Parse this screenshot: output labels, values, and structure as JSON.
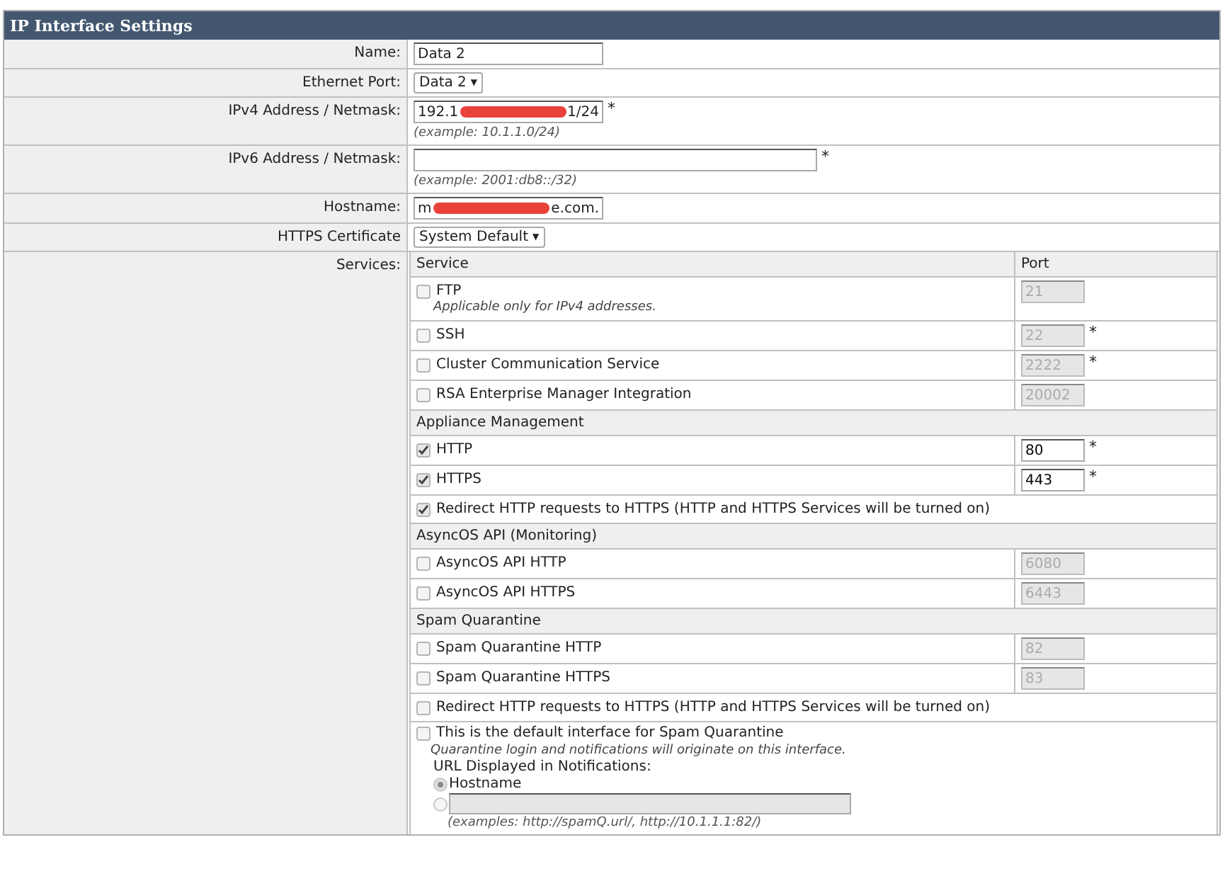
{
  "title": "IP Interface Settings",
  "fields": [
    {
      "kind": "text",
      "label": "Name:",
      "value": "Data 2",
      "wide": false
    },
    {
      "kind": "select",
      "label": "Ethernet Port:",
      "value": "Data 2",
      "arrow": "▼"
    },
    {
      "kind": "redacted",
      "label": "IPv4 Address / Netmask:",
      "value_start": "192.1",
      "value_end": "1/24",
      "asterisk": "*",
      "example": "(example: 10.1.1.0/24)"
    },
    {
      "kind": "text",
      "label": "IPv6 Address / Netmask:",
      "asterisk": "*",
      "example": "(example: 2001:db8::/32)",
      "wide": true
    },
    {
      "kind": "redacted",
      "label": "Hostname:",
      "value_start": "m",
      "value_end": "e.com."
    },
    {
      "kind": "select",
      "label": "HTTPS Certificate",
      "value": "System Default",
      "arrow": "▼"
    }
  ],
  "services": {
    "label": "Services:",
    "columns": [
      "Service",
      "Port"
    ],
    "rows": [
      {
        "kind": "service",
        "checked": false,
        "label": "FTP",
        "note": "Applicable only for IPv4 addresses.",
        "port": "21",
        "disabled": true
      },
      {
        "kind": "service",
        "checked": false,
        "label": "SSH",
        "port": "22",
        "disabled": true,
        "asterisk": "*"
      },
      {
        "kind": "service",
        "checked": false,
        "label": "Cluster Communication Service",
        "port": "2222",
        "disabled": true,
        "asterisk": "*"
      },
      {
        "kind": "service",
        "checked": false,
        "label": "RSA Enterprise Manager Integration",
        "port": "20002",
        "disabled": true
      },
      {
        "kind": "section",
        "label": "Appliance Management"
      },
      {
        "kind": "service",
        "checked": true,
        "label": "HTTP",
        "port": "80",
        "disabled": false,
        "asterisk": "*"
      },
      {
        "kind": "service",
        "checked": true,
        "label": "HTTPS",
        "port": "443",
        "disabled": false,
        "asterisk": "*"
      },
      {
        "kind": "option",
        "checked": true,
        "label": "Redirect HTTP requests to HTTPS (HTTP and HTTPS Services will be turned on)"
      },
      {
        "kind": "section",
        "label": "AsyncOS API (Monitoring)"
      },
      {
        "kind": "service",
        "checked": false,
        "label": "AsyncOS API HTTP",
        "port": "6080",
        "disabled": true
      },
      {
        "kind": "service",
        "checked": false,
        "label": "AsyncOS API HTTPS",
        "port": "6443",
        "disabled": true
      },
      {
        "kind": "section",
        "label": "Spam Quarantine"
      },
      {
        "kind": "service",
        "checked": false,
        "label": "Spam Quarantine HTTP",
        "port": "82",
        "disabled": true
      },
      {
        "kind": "service",
        "checked": false,
        "label": "Spam Quarantine HTTPS",
        "port": "83",
        "disabled": true
      },
      {
        "kind": "option",
        "checked": false,
        "label": "Redirect HTTP requests to HTTPS (HTTP and HTTPS Services will be turned on)"
      },
      {
        "kind": "default",
        "checked": false,
        "label": "This is the default interface for Spam Quarantine",
        "note": "Quarantine login and notifications will originate on this interface.",
        "url_label": "URL Displayed in Notifications:",
        "choices": [
          {
            "label": "Hostname",
            "selected": true
          },
          {
            "selected": false
          }
        ],
        "example": "(examples: http://spamQ.url/, http://10.1.1.1:82/)"
      }
    ]
  }
}
